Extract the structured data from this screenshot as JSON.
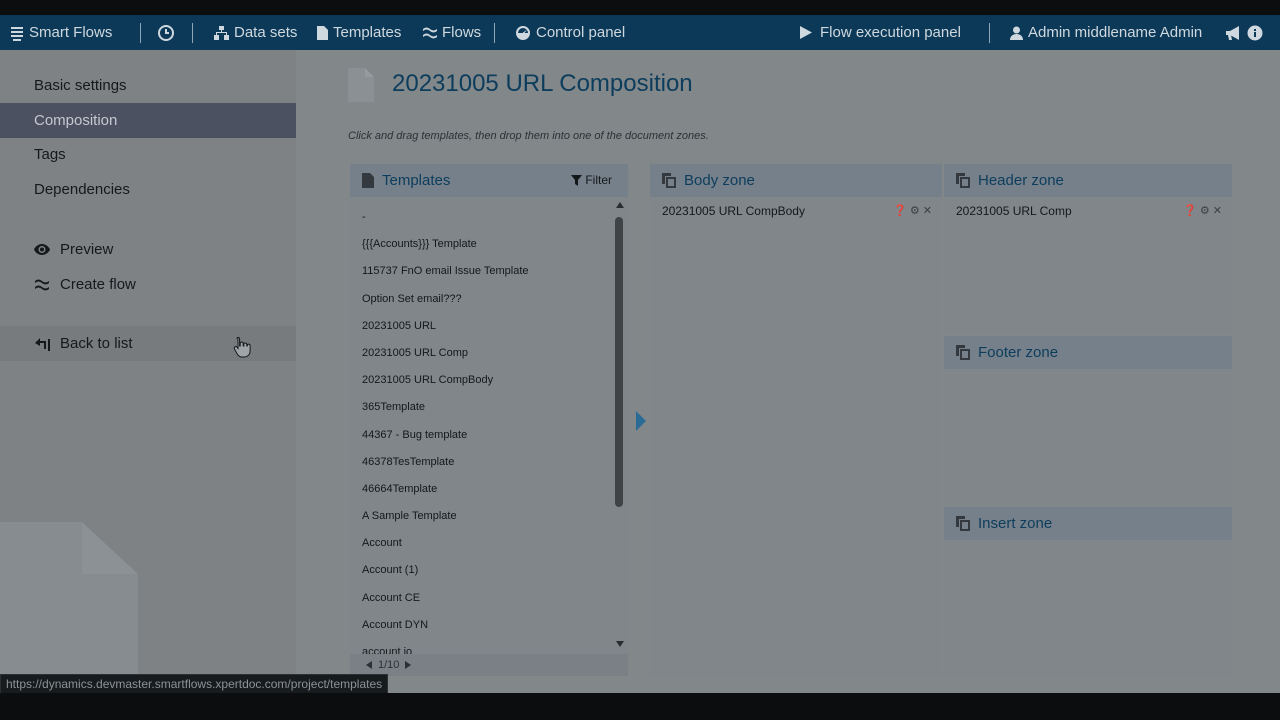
{
  "navbar": {
    "app_name": "Smart Flows",
    "history_label": "",
    "datasets_label": "Data sets",
    "templates_label": "Templates",
    "flows_label": "Flows",
    "control_panel_label": "Control panel",
    "flow_execution_label": "Flow execution panel",
    "user_label": "Admin middlename Admin"
  },
  "sidebar": {
    "items": [
      {
        "label": "Basic settings"
      },
      {
        "label": "Composition"
      },
      {
        "label": "Tags"
      },
      {
        "label": "Dependencies"
      },
      {
        "label": "Preview"
      },
      {
        "label": "Create flow"
      },
      {
        "label": "Back to list"
      }
    ]
  },
  "page": {
    "title": "20231005 URL Composition",
    "hint": "Click and drag templates, then drop them into one of the document zones."
  },
  "templates_panel": {
    "title": "Templates",
    "filter_label": "Filter",
    "items": [
      "-",
      "{{{Accounts}}} Template",
      "115737 FnO email Issue Template",
      "Option Set email???",
      "20231005 URL",
      "20231005 URL Comp",
      "20231005 URL CompBody",
      "365Template",
      "44367 - Bug template",
      "46378TesTemplate",
      "46664Template",
      "A Sample Template",
      "Account",
      "Account (1)",
      "Account CE",
      "Account DYN",
      "account io"
    ],
    "pager_text": "1/10"
  },
  "zones": {
    "body": {
      "title": "Body zone",
      "item": "20231005 URL CompBody"
    },
    "header": {
      "title": "Header zone",
      "item": "20231005 URL Comp"
    },
    "footer": {
      "title": "Footer zone"
    },
    "insert": {
      "title": "Insert zone"
    }
  },
  "status_url": "https://dynamics.devmaster.smartflows.xpertdoc.com/project/templates",
  "colors": {
    "navbar_bg": "#0c3958",
    "accent_title": "#0d3d5c",
    "active_item_bg": "#4b5160"
  }
}
